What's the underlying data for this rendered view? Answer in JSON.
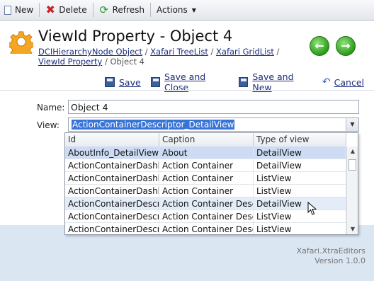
{
  "toolbar": {
    "new_label": "New",
    "delete_label": "Delete",
    "refresh_label": "Refresh",
    "actions_label": "Actions"
  },
  "header": {
    "title": "ViewId Property - Object 4",
    "breadcrumbs": [
      "DCIHierarchyNode Object",
      "Xafari TreeList",
      "Xafari GridList",
      "ViewId Property"
    ],
    "breadcrumb_current": "Object 4",
    "separator": "/"
  },
  "actions": {
    "save": "Save",
    "save_close": "Save and Close",
    "save_new": "Save and New",
    "cancel": "Cancel"
  },
  "form": {
    "name_label": "Name:",
    "name_value": "Object 4",
    "view_label": "View:",
    "view_value": "ActionContainerDescriptor_DetailView"
  },
  "dropdown": {
    "columns": [
      "Id",
      "Caption",
      "Type of view"
    ],
    "rows": [
      [
        "AboutInfo_DetailView",
        "About",
        "DetailView"
      ],
      [
        "ActionContainerDashb",
        "Action Container",
        "DetailView"
      ],
      [
        "ActionContainerDashb",
        "Action Container",
        "ListView"
      ],
      [
        "ActionContainerDashb",
        "Action Container",
        "ListView"
      ],
      [
        "ActionContainerDescri",
        "Action Container Desc",
        "DetailView"
      ],
      [
        "ActionContainerDescri",
        "Action Container Desc",
        "ListView"
      ],
      [
        "ActionContainerDescri",
        "Action Container Desc",
        "ListView"
      ]
    ]
  },
  "footer": {
    "product": "Xafari.XtraEditors",
    "version": "Version 1.0.0"
  },
  "colors": {
    "selection": "#3874d8",
    "link": "#1b2d7a",
    "footer_band": "#dbe6f3"
  }
}
